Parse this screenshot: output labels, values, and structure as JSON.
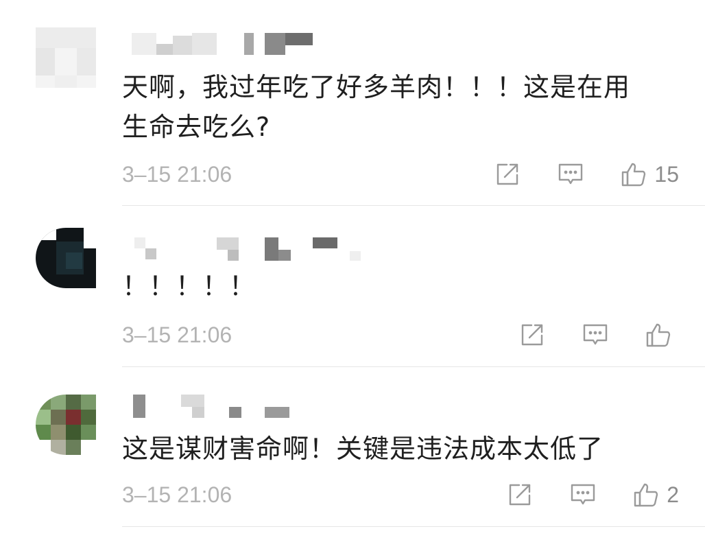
{
  "icons": {
    "share": "share-icon",
    "reply": "comment-icon",
    "like": "thumbs-up-icon"
  },
  "colors": {
    "meta": "#b3b3b3",
    "icon": "#9a9a9a",
    "text": "#1f1f1f",
    "divider": "#e6e6e6"
  },
  "comments": [
    {
      "text_line1": "天啊，我过年吃了好多羊肉！！！这是在用",
      "text_line2": "生命去吃么?",
      "time": "3–15 21:06",
      "likes": "15"
    },
    {
      "text_line1": "！！！！！",
      "text_line2": "",
      "time": "3–15 21:06",
      "likes": ""
    },
    {
      "text_line1": "这是谋财害命啊！关键是违法成本太低了",
      "text_line2": "",
      "time": "3–15 21:06",
      "likes": "2"
    }
  ]
}
